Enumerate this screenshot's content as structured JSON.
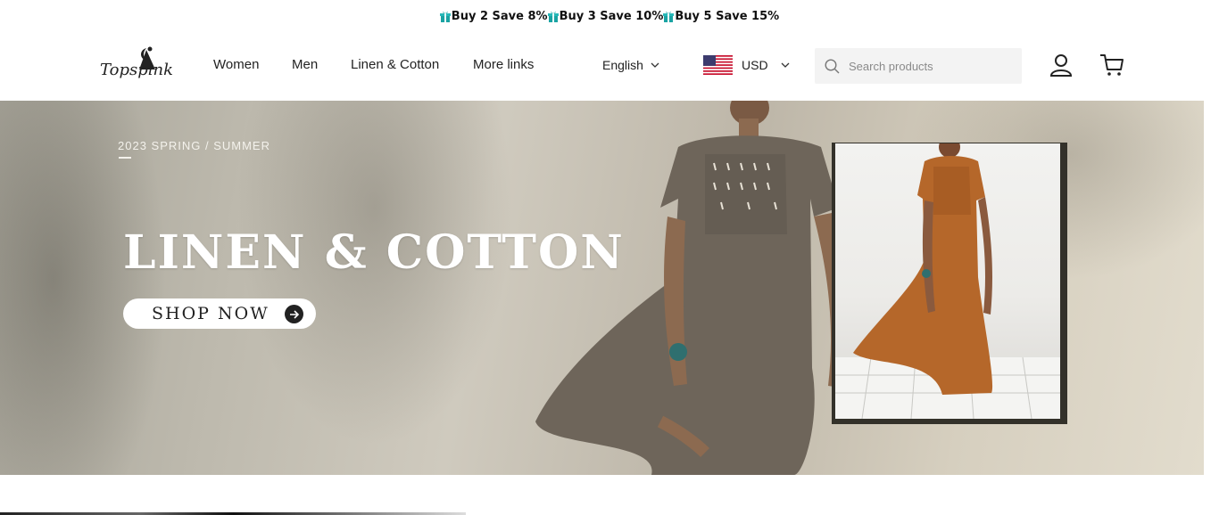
{
  "announcement": {
    "segments": [
      "Buy 2 Save 8%",
      "Buy 3 Save 10%",
      "Buy 5 Save 15%"
    ],
    "icon": "gift-icon"
  },
  "header": {
    "logo_text": "Topspink",
    "nav": [
      "Women",
      "Men",
      "Linen & Cotton",
      "More links"
    ],
    "language": "English",
    "currency": "USD",
    "search_placeholder": "Search products"
  },
  "hero": {
    "season": "2023 SPRING / SUMMER",
    "title": "LINEN & COTTON",
    "cta": "SHOP NOW"
  },
  "colors": {
    "accent_gift": "#1aa3a3",
    "text": "#222222",
    "search_bg": "#f3f3f3"
  }
}
